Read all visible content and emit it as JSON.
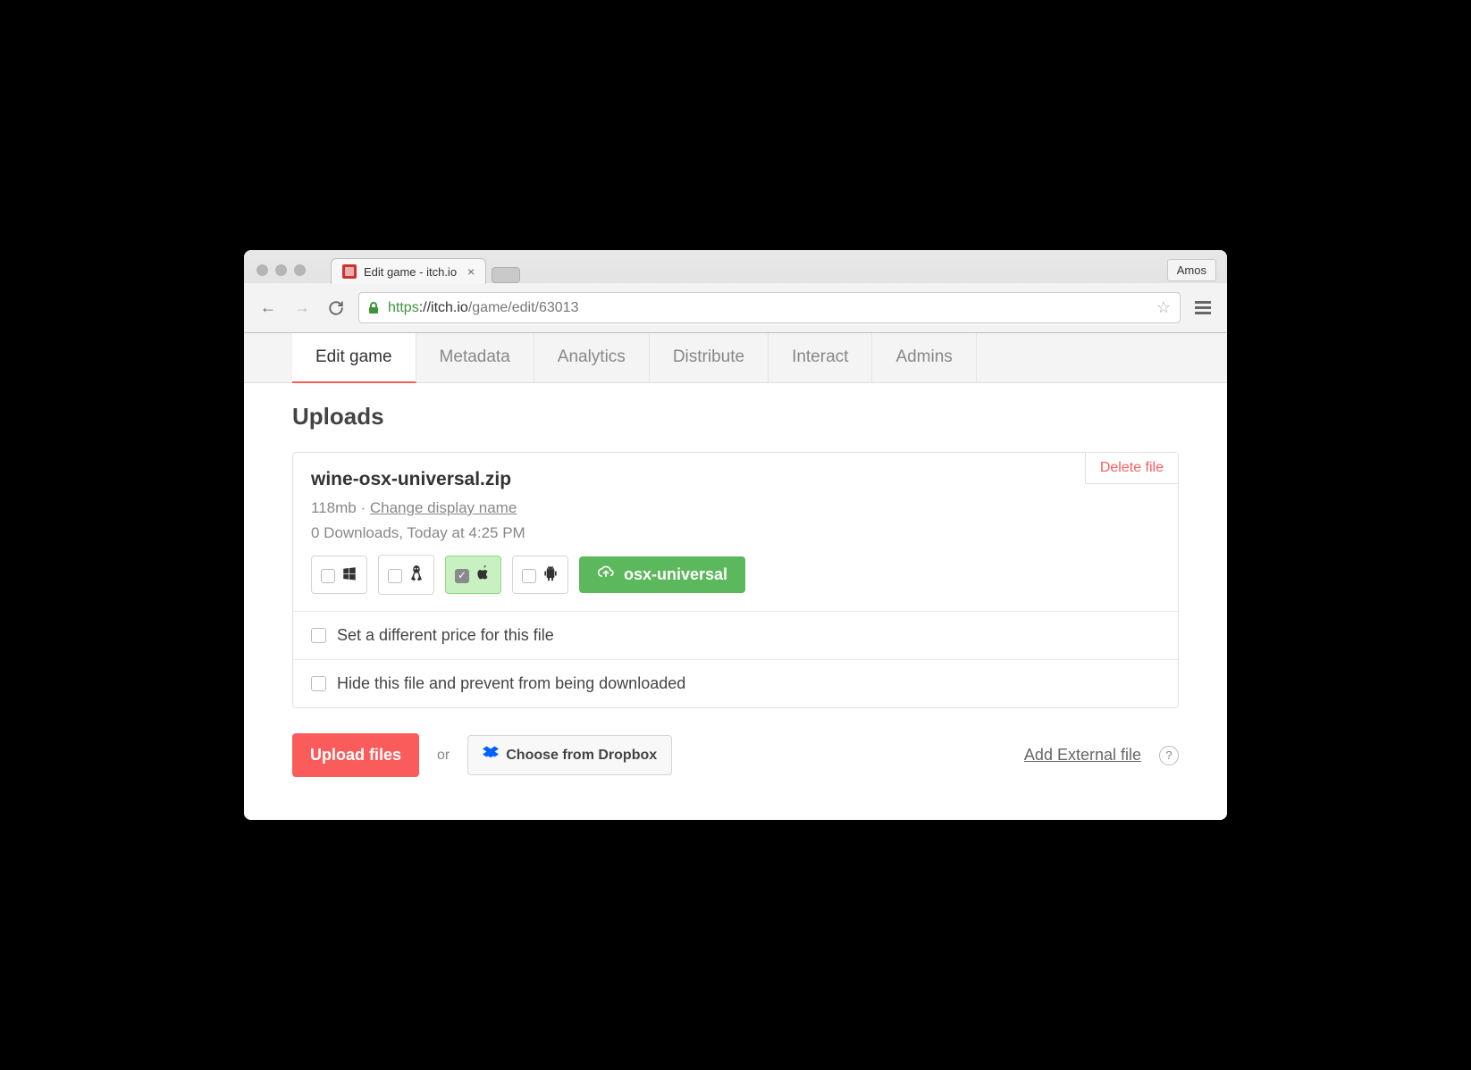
{
  "browser": {
    "tab_title": "Edit game - itch.io",
    "profile": "Amos",
    "url_scheme": "https",
    "url_host": "://itch.io",
    "url_path": "/game/edit/63013"
  },
  "tabs": {
    "edit_game": "Edit game",
    "metadata": "Metadata",
    "analytics": "Analytics",
    "distribute": "Distribute",
    "interact": "Interact",
    "admins": "Admins"
  },
  "section": {
    "uploads_title": "Uploads"
  },
  "upload": {
    "filename": "wine-osx-universal.zip",
    "size": "118mb",
    "dot": "·",
    "change_name": "Change display name",
    "stats": "0 Downloads, Today at 4:25 PM",
    "delete": "Delete file",
    "channel": "osx-universal",
    "opt_price": "Set a different price for this file",
    "opt_hide": "Hide this file and prevent from being downloaded"
  },
  "actions": {
    "upload": "Upload files",
    "or": "or",
    "dropbox": "Choose from Dropbox",
    "external": "Add External file",
    "help": "?"
  }
}
